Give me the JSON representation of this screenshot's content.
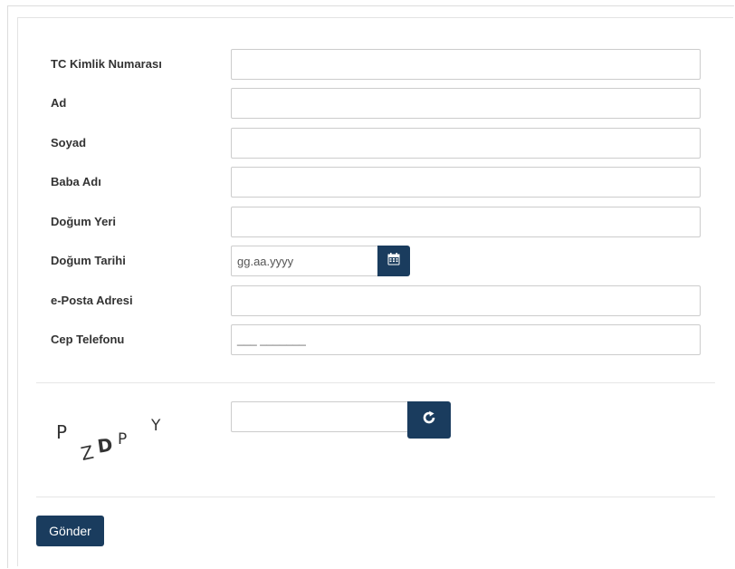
{
  "form": {
    "fields": [
      {
        "label": "TC Kimlik Numarası",
        "value": "",
        "placeholder": ""
      },
      {
        "label": "Ad",
        "value": "",
        "placeholder": ""
      },
      {
        "label": "Soyad",
        "value": "",
        "placeholder": ""
      },
      {
        "label": "Baba Adı",
        "value": "",
        "placeholder": ""
      },
      {
        "label": "Doğum Yeri",
        "value": "",
        "placeholder": ""
      },
      {
        "label": "Doğum Tarihi",
        "value": "",
        "placeholder": "gg.aa.yyyy"
      },
      {
        "label": "e-Posta Adresi",
        "value": "",
        "placeholder": ""
      },
      {
        "label": "Cep Telefonu",
        "value": "",
        "placeholder": "",
        "mask": "___ _______"
      }
    ]
  },
  "captcha": {
    "code": "PZDPY",
    "input_value": "",
    "refresh_icon": "refresh-icon"
  },
  "calendar_icon": "calendar-icon",
  "submit_label": "Gönder",
  "colors": {
    "accent": "#1a3c5e",
    "border": "#cccccc",
    "label_text": "#333333"
  }
}
